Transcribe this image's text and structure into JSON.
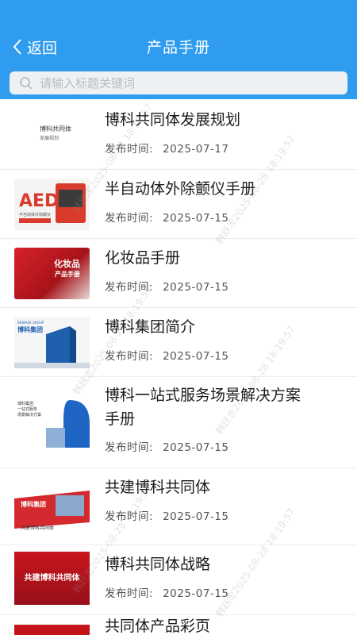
{
  "header": {
    "back_label": "返回",
    "title": "产品手册",
    "bg_color": "#2f9cf0"
  },
  "search": {
    "placeholder": "请输入标题关键词",
    "icon": "search-icon"
  },
  "date_label": "发布时间:",
  "items": [
    {
      "title": "博科共同体发展规划",
      "date": "2025-07-17",
      "thumb_line1": "博科共同体",
      "thumb_line2": "发展规划"
    },
    {
      "title": "半自动体外除颤仪手册",
      "date": "2025-07-15",
      "thumb_text": "AED",
      "thumb_caption": "半自动体外除颤仪"
    },
    {
      "title": "化妆品手册",
      "date": "2025-07-15",
      "thumb_line1": "化妆品",
      "thumb_line2": "产品手册"
    },
    {
      "title": "博科集团简介",
      "date": "2025-07-15",
      "thumb_brand_en": "BIOBASE GROUP",
      "thumb_brand": "博科集团"
    },
    {
      "title_line1": "博科一站式服务场景解决方案",
      "title_line2": "手册",
      "date": "2025-07-15",
      "thumb_line1": "博科集团",
      "thumb_line2": "一站式服务",
      "thumb_line3": "场景解决方案"
    },
    {
      "title": "共建博科共同体",
      "date": "2025-07-15",
      "thumb_brand": "博科集团",
      "thumb_caption": "共建博科共同体"
    },
    {
      "title": "博科共同体战略",
      "date": "2025-07-15",
      "thumb_text": "共建博科共同体"
    },
    {
      "title": "共同体产品彩页",
      "date": ""
    }
  ],
  "watermark": "韩跃忠2025-08-28 18:19:57"
}
